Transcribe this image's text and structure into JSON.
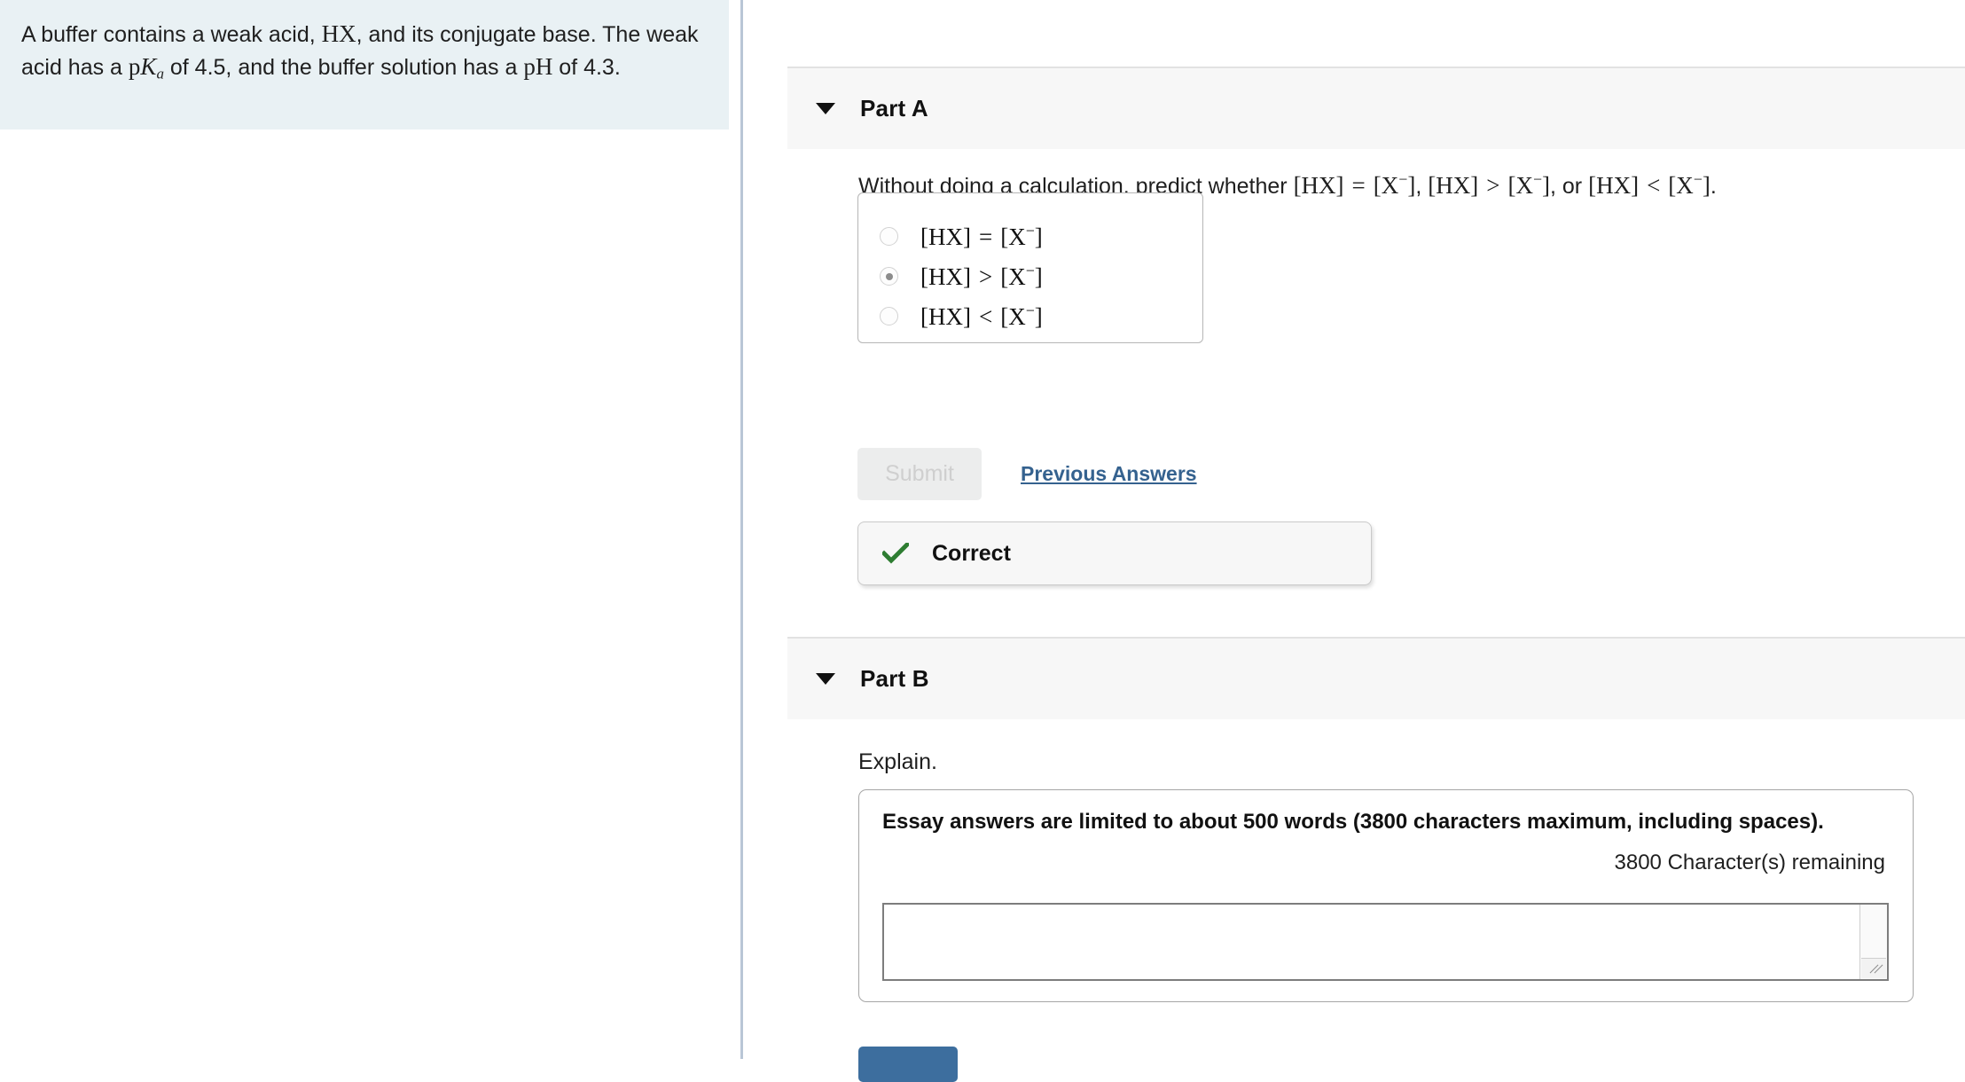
{
  "problem": {
    "text_before_hx": "A buffer contains a weak acid, ",
    "hx": "HX",
    "text_after_hx": ", and its conjugate base. The weak acid has a ",
    "pk": "p",
    "pk_italic": "K",
    "pk_sub": "a",
    "text_after_pka": " of 4.5, and the buffer solution has a ",
    "ph": "pH",
    "text_after_ph": " of 4.3."
  },
  "part_a": {
    "title": "Part A",
    "caret": "caret-down-icon",
    "question": {
      "lead": "Without doing a calculation, predict whether ",
      "term_hx": "[HX]",
      "term_x": "[X",
      "term_x_sup": "−",
      "term_x_close": "]",
      "rel_eq": "=",
      "rel_gt": ">",
      "rel_lt": "<",
      "comma": ", ",
      "or_text": ", or ",
      "period": "."
    },
    "choices": [
      {
        "label_left": "[HX]",
        "rel": "=",
        "label_right_base": "[X",
        "label_right_sup": "−",
        "label_right_close": "]",
        "selected": false
      },
      {
        "label_left": "[HX]",
        "rel": ">",
        "label_right_base": "[X",
        "label_right_sup": "−",
        "label_right_close": "]",
        "selected": true
      },
      {
        "label_left": "[HX]",
        "rel": "<",
        "label_right_base": "[X",
        "label_right_sup": "−",
        "label_right_close": "]",
        "selected": false
      }
    ],
    "submit_label": "Submit",
    "submit_disabled": true,
    "previous_answers_label": "Previous Answers",
    "feedback": {
      "label": "Correct",
      "icon": "check-icon",
      "color": "#2e7d32"
    }
  },
  "part_b": {
    "title": "Part B",
    "caret": "caret-down-icon",
    "prompt": "Explain.",
    "essay_limit_note": "Essay answers are limited to about 500 words (3800 characters maximum, including spaces).",
    "chars_remaining": "3800 Character(s) remaining",
    "textarea_value": "",
    "textarea_placeholder": "",
    "submit_color": "#3d6e9e"
  },
  "colors": {
    "problem_panel_bg": "#e9f1f4",
    "divider": "#b9c6d6",
    "band_bg": "#f7f7f7",
    "link": "#35628f",
    "correct_green": "#2e7d32",
    "submit_disabled_bg": "#eceded"
  }
}
